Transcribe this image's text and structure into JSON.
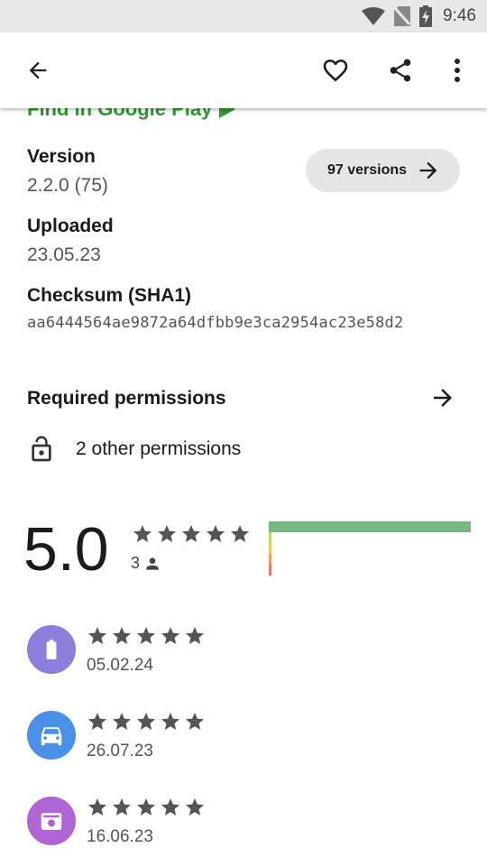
{
  "status_bar": {
    "time": "9:46"
  },
  "app_bar": {
    "back_icon": "arrow-back-icon",
    "favorite_icon": "heart-outline-icon",
    "share_icon": "share-icon",
    "more_icon": "more-vertical-icon"
  },
  "partial_text": "Find in Google Play",
  "details": {
    "version_label": "Version",
    "version_value": "2.2.0 (75)",
    "versions_button": "97 versions",
    "uploaded_label": "Uploaded",
    "uploaded_value": "23.05.23",
    "checksum_label": "Checksum (SHA1)",
    "checksum_value": "aa6444564ae9872a64dfbb9e3ca2954ac23e58d2"
  },
  "permissions": {
    "header": "Required permissions",
    "other": "2 other permissions"
  },
  "rating": {
    "score": "5.0",
    "stars": 5,
    "count": "3",
    "histogram": [
      {
        "stars": 5,
        "fraction": 1.0,
        "color": "#74b884"
      },
      {
        "stars": 4,
        "fraction": 0.0,
        "color": "#c5d36a"
      },
      {
        "stars": 3,
        "fraction": 0.0,
        "color": "#f1c95c"
      },
      {
        "stars": 2,
        "fraction": 0.0,
        "color": "#f0a05a"
      },
      {
        "stars": 1,
        "fraction": 0.0,
        "color": "#e5786a"
      }
    ]
  },
  "reviews": [
    {
      "stars": 5,
      "date": "05.02.24",
      "avatar_icon": "battery-icon",
      "avatar_color": "#8a7fdc"
    },
    {
      "stars": 5,
      "date": "26.07.23",
      "avatar_icon": "car-icon",
      "avatar_color": "#4a90e8"
    },
    {
      "stars": 5,
      "date": "16.06.23",
      "avatar_icon": "radio-icon",
      "avatar_color": "#b065d4"
    }
  ],
  "colors": {
    "star": "#555555",
    "accent_green": "#2e9a30"
  }
}
